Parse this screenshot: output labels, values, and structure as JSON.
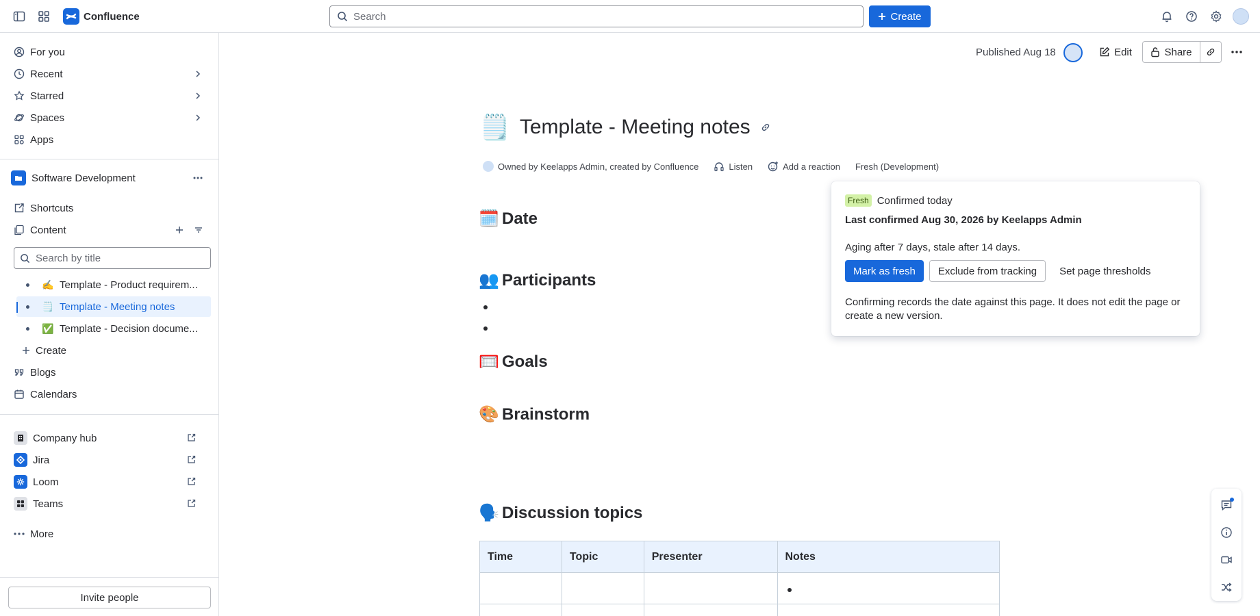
{
  "topbar": {
    "app_name": "Confluence",
    "search_placeholder": "Search",
    "create_label": "Create"
  },
  "sidebar": {
    "nav": [
      {
        "label": "For you"
      },
      {
        "label": "Recent"
      },
      {
        "label": "Starred"
      },
      {
        "label": "Spaces"
      },
      {
        "label": "Apps"
      }
    ],
    "space_name": "Software Development",
    "shortcuts_label": "Shortcuts",
    "content_label": "Content",
    "search_placeholder": "Search by title",
    "tree": [
      {
        "emoji": "✍️",
        "label": "Template - Product requirem..."
      },
      {
        "emoji": "🗒️",
        "label": "Template - Meeting notes"
      },
      {
        "emoji": "✅",
        "label": "Template - Decision docume..."
      }
    ],
    "tree_create": "Create",
    "blogs_label": "Blogs",
    "calendars_label": "Calendars",
    "apps": [
      {
        "label": "Company hub"
      },
      {
        "label": "Jira"
      },
      {
        "label": "Loom"
      },
      {
        "label": "Teams"
      }
    ],
    "more_label": "More",
    "invite_label": "Invite people"
  },
  "page": {
    "published": "Published Aug 18",
    "edit_label": "Edit",
    "share_label": "Share",
    "title_emoji": "🗒️",
    "title": "Template - Meeting notes",
    "byline": "Owned by Keelapps Admin, created by Confluence",
    "listen": "Listen",
    "reaction": "Add a reaction",
    "freshness": "Fresh (Development)",
    "headings": {
      "date": {
        "emoji": "🗓️",
        "text": "Date"
      },
      "participants": {
        "emoji": "👥",
        "text": "Participants"
      },
      "goals": {
        "emoji": "🥅",
        "text": "Goals"
      },
      "brainstorm": {
        "emoji": "🎨",
        "text": "Brainstorm"
      },
      "discussion": {
        "emoji": "🗣️",
        "text": "Discussion topics"
      }
    },
    "table": {
      "headers": [
        "Time",
        "Topic",
        "Presenter",
        "Notes"
      ]
    }
  },
  "popup": {
    "badge": "Fresh",
    "confirmed": "Confirmed today",
    "last_confirmed": "Last confirmed Aug 30, 2026 by Keelapps Admin",
    "aging": "Aging after 7 days, stale after 14 days.",
    "btn_mark": "Mark as fresh",
    "btn_exclude": "Exclude from tracking",
    "btn_thresholds": "Set page thresholds",
    "note": "Confirming records the date against this page. It does not edit the page or create a new version."
  }
}
